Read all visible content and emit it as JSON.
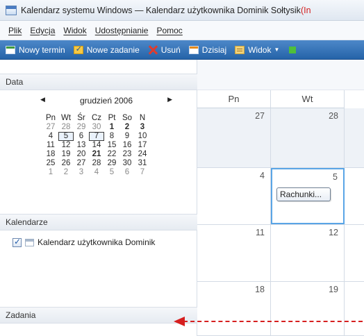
{
  "window": {
    "title": "Kalendarz systemu Windows — Kalendarz użytkownika Dominik Sołtysik",
    "title_suffix": "(In"
  },
  "menu": [
    "Plik",
    "Edycja",
    "Widok",
    "Udostępnianie",
    "Pomoc"
  ],
  "toolbar": {
    "new_appointment": "Nowy termin",
    "new_task": "Nowe zadanie",
    "delete": "Usuń",
    "today": "Dzisiaj",
    "view": "Widok",
    "view_caret": "▼"
  },
  "left_pane": {
    "date_header": "Data",
    "calendars_header": "Kalendarze",
    "tasks_header": "Zadania",
    "calendar_item": "Kalendarz użytkownika Dominik"
  },
  "mini_calendar": {
    "prev": "◀",
    "next": "▶",
    "month": "grudzień 2006",
    "weekdays": [
      "Pn",
      "Wt",
      "Śr",
      "Cz",
      "Pt",
      "So",
      "N"
    ],
    "weeks": [
      [
        "27",
        "28",
        "29",
        "30",
        "1",
        "2",
        "3"
      ],
      [
        "4",
        "5",
        "6",
        "7",
        "8",
        "9",
        "10"
      ],
      [
        "11",
        "12",
        "13",
        "14",
        "15",
        "16",
        "17"
      ],
      [
        "18",
        "19",
        "20",
        "21",
        "22",
        "23",
        "24"
      ],
      [
        "25",
        "26",
        "27",
        "28",
        "29",
        "30",
        "31"
      ],
      [
        "1",
        "2",
        "3",
        "4",
        "5",
        "6",
        "7"
      ]
    ]
  },
  "week_view": {
    "day_headers": [
      "Pn",
      "Wt"
    ],
    "rows": [
      [
        "27",
        "28"
      ],
      [
        "4",
        "5"
      ],
      [
        "11",
        "12"
      ],
      [
        "18",
        "19"
      ]
    ],
    "event": "Rachunki..."
  },
  "colors": {
    "toolbar_bg": "#2f6db3",
    "selection_border": "#5aa5e6",
    "annotation_arrow": "#d61f1f"
  }
}
